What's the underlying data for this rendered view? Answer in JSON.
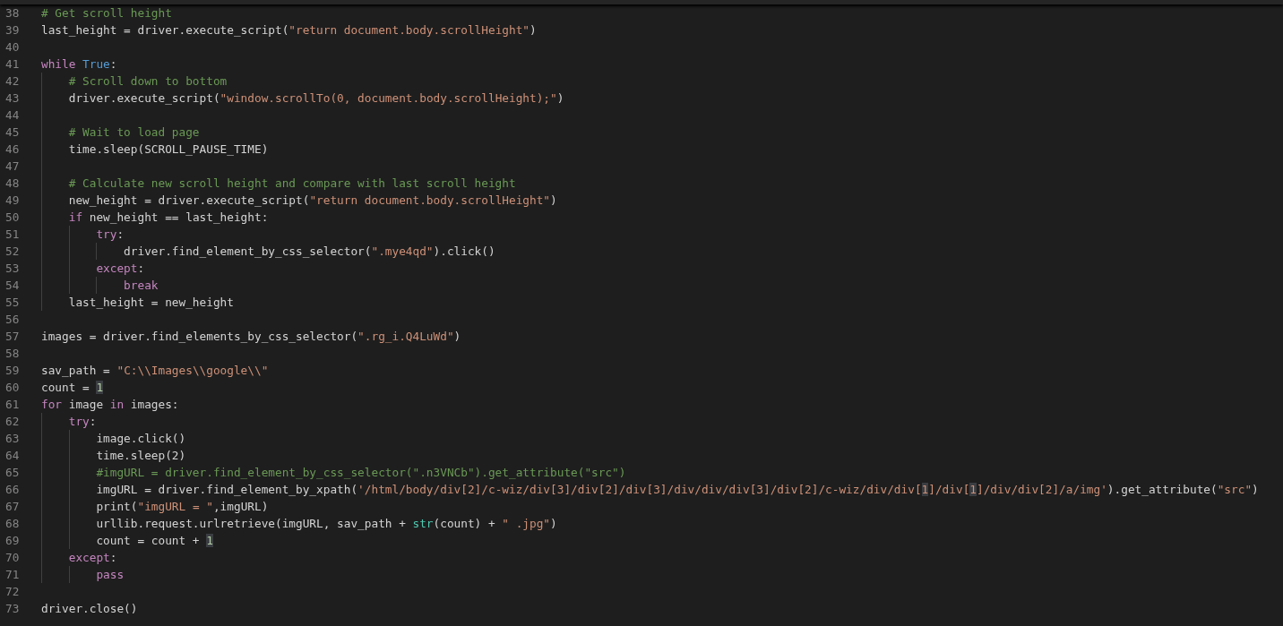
{
  "editor": {
    "lines": [
      {
        "number": "38",
        "tokens": [
          {
            "kind": "comment",
            "text": "# Get scroll height"
          }
        ]
      },
      {
        "number": "39",
        "tokens": [
          {
            "kind": "plain",
            "text": "last_height = driver.execute_script("
          },
          {
            "kind": "string",
            "text": "\"return document.body.scrollHeight\""
          },
          {
            "kind": "plain",
            "text": ")"
          }
        ]
      },
      {
        "number": "40"
      },
      {
        "number": "41",
        "tokens": [
          {
            "kind": "keyword",
            "text": "while"
          },
          {
            "kind": "constant",
            "text": " True"
          },
          {
            "kind": "plain",
            "text": ":"
          }
        ]
      },
      {
        "number": "42",
        "tokens": [
          {
            "kind": "comment",
            "text": "    # Scroll down to bottom"
          }
        ]
      },
      {
        "number": "43",
        "tokens": [
          {
            "kind": "plain",
            "text": "    driver.execute_script("
          },
          {
            "kind": "string",
            "text": "\"window.scrollTo(0, document.body.scrollHeight);\""
          },
          {
            "kind": "plain",
            "text": ")"
          }
        ]
      },
      {
        "number": "44"
      },
      {
        "number": "45",
        "tokens": [
          {
            "kind": "comment",
            "text": "    # Wait to load page"
          }
        ]
      },
      {
        "number": "46",
        "tokens": [
          {
            "kind": "plain",
            "text": "    time.sleep(SCROLL_PAUSE_TIME)"
          }
        ]
      },
      {
        "number": "47"
      },
      {
        "number": "48",
        "tokens": [
          {
            "kind": "comment",
            "text": "    # Calculate new scroll height and compare with last scroll height"
          }
        ]
      },
      {
        "number": "49",
        "tokens": [
          {
            "kind": "plain",
            "text": "    new_height = driver.execute_script("
          },
          {
            "kind": "string",
            "text": "\"return document.body.scrollHeight\""
          },
          {
            "kind": "plain",
            "text": ")"
          }
        ]
      },
      {
        "number": "50",
        "tokens": [
          {
            "kind": "keyword",
            "text": "    if"
          },
          {
            "kind": "plain",
            "text": " new_height == last_height:"
          }
        ]
      },
      {
        "number": "51",
        "tokens": [
          {
            "kind": "keyword",
            "text": "        try"
          },
          {
            "kind": "plain",
            "text": ":"
          }
        ]
      },
      {
        "number": "52",
        "tokens": [
          {
            "kind": "plain",
            "text": "            driver.find_element_by_css_selector("
          },
          {
            "kind": "string",
            "text": "\".mye4qd\""
          },
          {
            "kind": "plain",
            "text": ").click()"
          }
        ]
      },
      {
        "number": "53",
        "tokens": [
          {
            "kind": "keyword",
            "text": "        except"
          },
          {
            "kind": "plain",
            "text": ":"
          }
        ]
      },
      {
        "number": "54",
        "tokens": [
          {
            "kind": "keyword",
            "text": "            break"
          }
        ]
      },
      {
        "number": "55",
        "tokens": [
          {
            "kind": "plain",
            "text": "    last_height = new_height"
          }
        ]
      },
      {
        "number": "56"
      },
      {
        "number": "57",
        "tokens": [
          {
            "kind": "plain",
            "text": "images = driver.find_elements_by_css_selector("
          },
          {
            "kind": "string",
            "text": "\".rg_i.Q4LuWd\""
          },
          {
            "kind": "plain",
            "text": ")"
          }
        ]
      },
      {
        "number": "58"
      },
      {
        "number": "59",
        "tokens": [
          {
            "kind": "plain",
            "text": "sav_path = "
          },
          {
            "kind": "string",
            "text": "\"C:\\\\Images\\\\google\\\\\""
          }
        ]
      },
      {
        "number": "60",
        "tokens": [
          {
            "kind": "plain",
            "text": "count = "
          },
          {
            "kind": "number-match",
            "text": "1"
          }
        ]
      },
      {
        "number": "61",
        "tokens": [
          {
            "kind": "keyword",
            "text": "for"
          },
          {
            "kind": "plain",
            "text": " image "
          },
          {
            "kind": "keyword",
            "text": "in"
          },
          {
            "kind": "plain",
            "text": " images:"
          }
        ]
      },
      {
        "number": "62",
        "tokens": [
          {
            "kind": "keyword",
            "text": "    try"
          },
          {
            "kind": "plain",
            "text": ":"
          }
        ]
      },
      {
        "number": "63",
        "tokens": [
          {
            "kind": "plain",
            "text": "        image.click()"
          }
        ]
      },
      {
        "number": "64",
        "tokens": [
          {
            "kind": "plain",
            "text": "        time.sleep(2)"
          }
        ]
      },
      {
        "number": "65",
        "tokens": [
          {
            "kind": "comment",
            "text": "        #imgURL = driver.find_element_by_css_selector(\".n3VNCb\").get_attribute(\"src\")"
          }
        ]
      },
      {
        "number": "66",
        "tokens": [
          {
            "kind": "plain",
            "text": "        imgURL = driver.find_element_by_xpath("
          },
          {
            "kind": "string",
            "text": "'/html/body/div[2]/c-wiz/div[3]/div[2]/div[3]/div/div/div[3]/div[2]/c-wiz/div/div["
          },
          {
            "kind": "string-match",
            "text": "1"
          },
          {
            "kind": "string",
            "text": "]/div["
          },
          {
            "kind": "string-match",
            "text": "1"
          },
          {
            "kind": "string",
            "text": "]/div/div[2]/a/img'"
          },
          {
            "kind": "plain",
            "text": ").get_attribute("
          },
          {
            "kind": "string",
            "text": "\"src\""
          },
          {
            "kind": "plain",
            "text": ")"
          }
        ]
      },
      {
        "number": "67",
        "tokens": [
          {
            "kind": "plain",
            "text": "        print("
          },
          {
            "kind": "string",
            "text": "\"imgURL = \""
          },
          {
            "kind": "plain",
            "text": ",imgURL)"
          }
        ]
      },
      {
        "number": "68",
        "tokens": [
          {
            "kind": "plain",
            "text": "        urllib.request.urlretrieve(imgURL, sav_path + "
          },
          {
            "kind": "builtin",
            "text": "str"
          },
          {
            "kind": "plain",
            "text": "(count) + "
          },
          {
            "kind": "string",
            "text": "\" .jpg\""
          },
          {
            "kind": "plain",
            "text": ")"
          }
        ]
      },
      {
        "number": "69",
        "tokens": [
          {
            "kind": "plain",
            "text": "        count = count + "
          },
          {
            "kind": "number-match",
            "text": "1"
          }
        ]
      },
      {
        "number": "70",
        "tokens": [
          {
            "kind": "keyword",
            "text": "    except"
          },
          {
            "kind": "plain",
            "text": ":"
          }
        ]
      },
      {
        "number": "71",
        "tokens": [
          {
            "kind": "keyword",
            "text": "        pass"
          }
        ]
      },
      {
        "number": "72"
      },
      {
        "number": "73",
        "tokens": [
          {
            "kind": "plain",
            "text": "driver.close()"
          }
        ]
      }
    ]
  }
}
